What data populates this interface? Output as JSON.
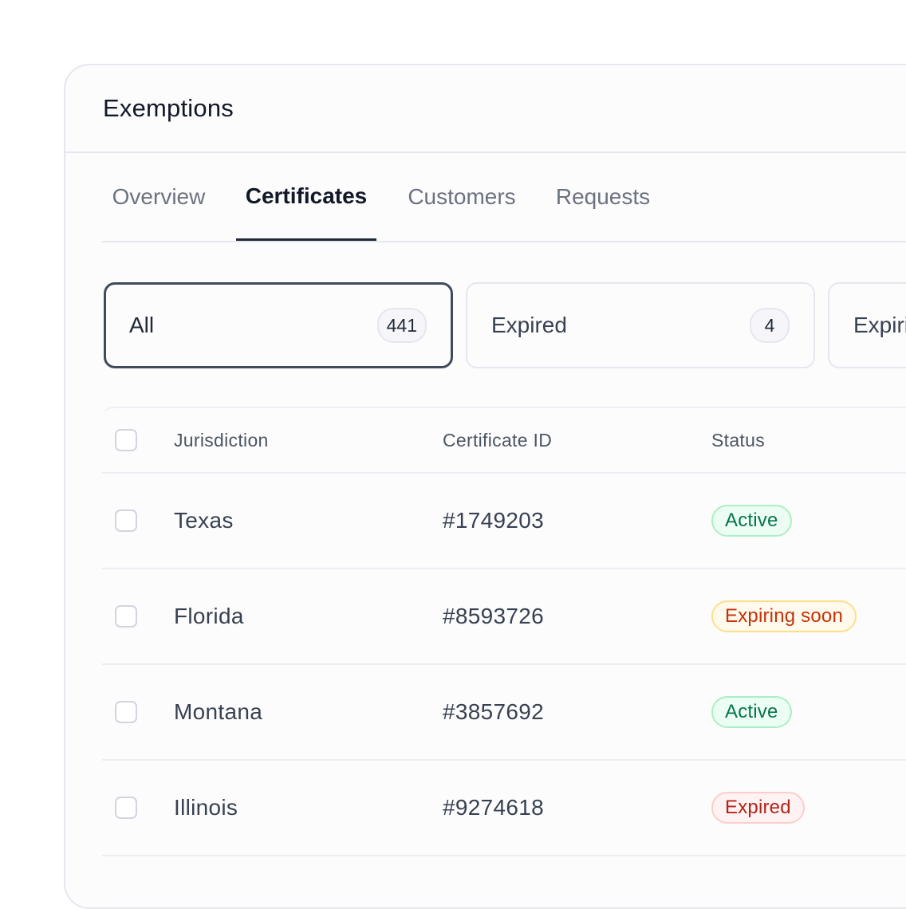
{
  "header": {
    "title": "Exemptions"
  },
  "tabs": [
    {
      "label": "Overview",
      "active": false
    },
    {
      "label": "Certificates",
      "active": true
    },
    {
      "label": "Customers",
      "active": false
    },
    {
      "label": "Requests",
      "active": false
    }
  ],
  "filters": [
    {
      "label": "All",
      "count": "441",
      "selected": true
    },
    {
      "label": "Expired",
      "count": "4",
      "selected": false
    },
    {
      "label": "Expiring soon",
      "count": "",
      "selected": false
    }
  ],
  "table": {
    "columns": [
      "Jurisdiction",
      "Certificate ID",
      "Status"
    ],
    "rows": [
      {
        "jurisdiction": "Texas",
        "certificate_id": "#1749203",
        "status": "Active",
        "status_type": "active"
      },
      {
        "jurisdiction": "Florida",
        "certificate_id": "#8593726",
        "status": "Expiring soon",
        "status_type": "expiring"
      },
      {
        "jurisdiction": "Montana",
        "certificate_id": "#3857692",
        "status": "Active",
        "status_type": "active"
      },
      {
        "jurisdiction": "Illinois",
        "certificate_id": "#9274618",
        "status": "Expired",
        "status_type": "expired"
      }
    ]
  },
  "colors": {
    "active_text": "#067647",
    "expiring_text": "#c4320a",
    "expired_text": "#b42318",
    "selected_border": "#3f4a5c"
  }
}
